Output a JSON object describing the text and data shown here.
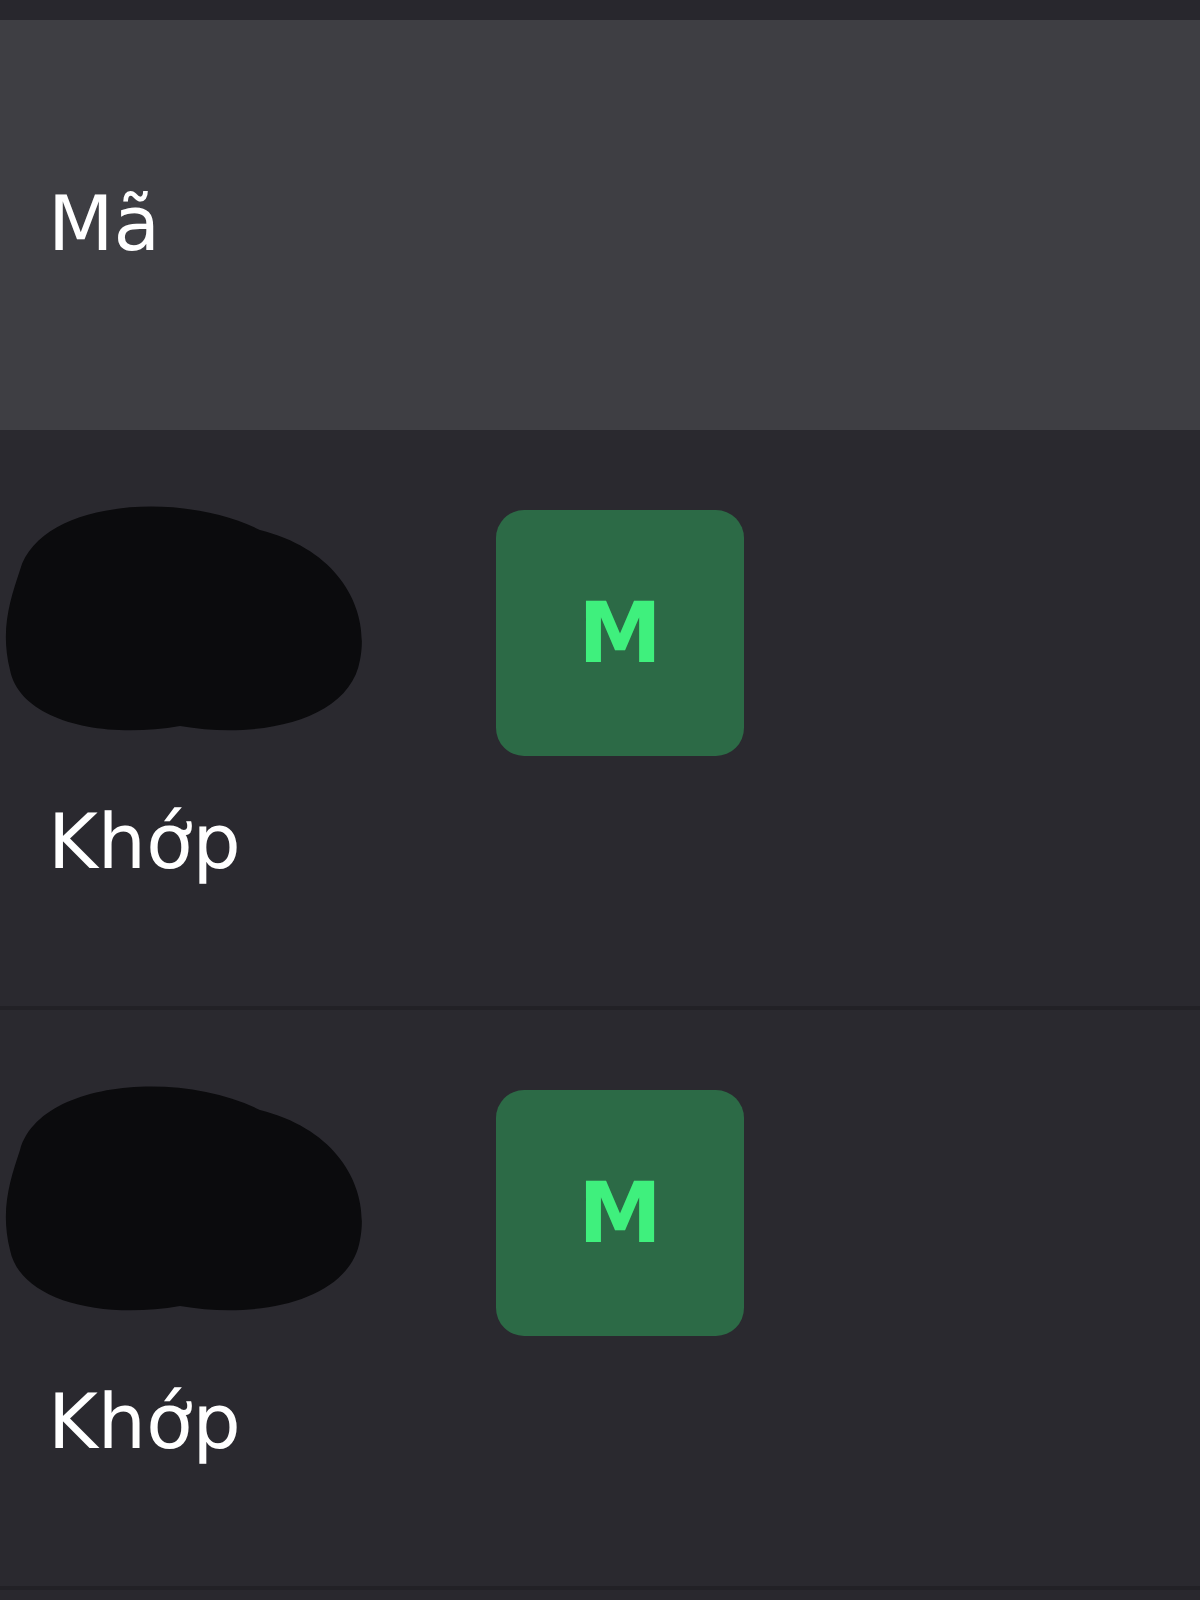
{
  "header": {
    "title": "Mã"
  },
  "rows": [
    {
      "status": "Khớp",
      "badge": "M"
    },
    {
      "status": "Khớp",
      "badge": "M"
    }
  ]
}
